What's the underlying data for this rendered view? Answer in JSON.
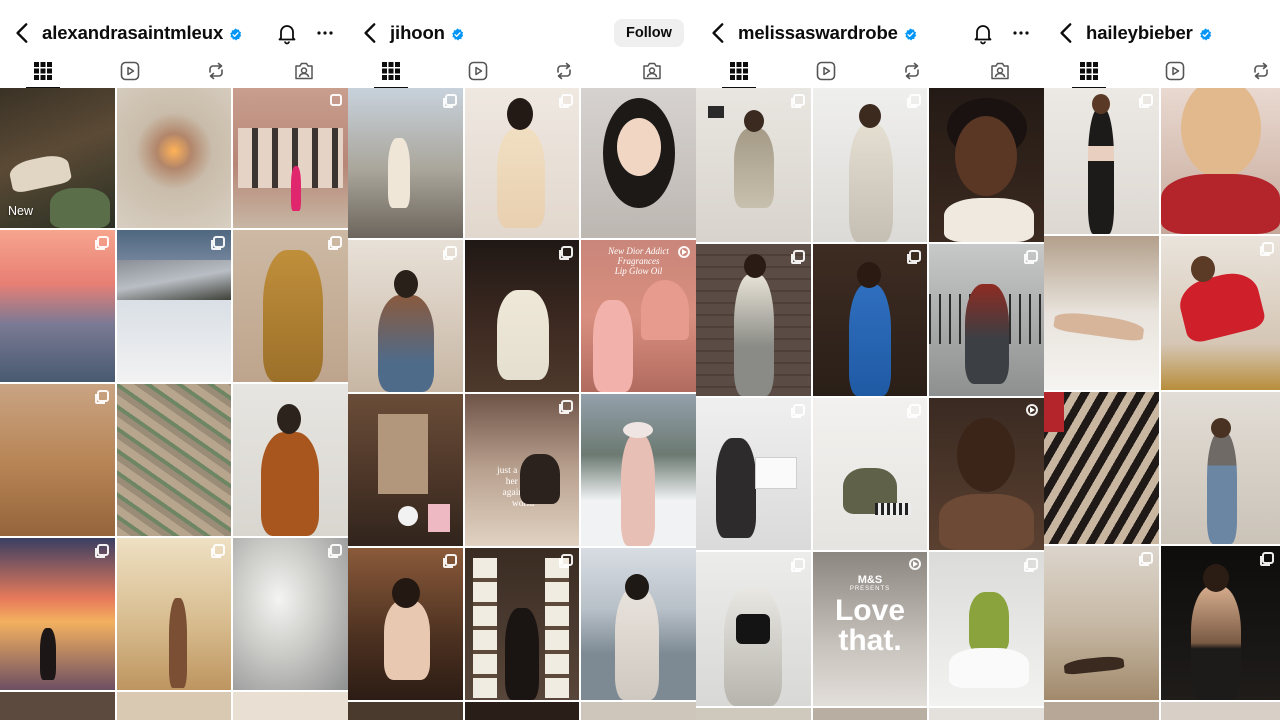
{
  "panels": [
    {
      "username": "alexandrasaintmleux",
      "verified": true,
      "right_icons": [
        "bell-icon",
        "more-icon"
      ],
      "new_label": "New"
    },
    {
      "username": "jihoon",
      "verified": true,
      "follow_label": "Follow",
      "overlays": {
        "tile_1_2": [
          "New Dior Addict",
          "Fragrances",
          "Lip Glow Oil"
        ],
        "tile_2_1": [
          "just a girl and",
          "her notes",
          "against the",
          "world"
        ]
      }
    },
    {
      "username": "melissaswardrobe",
      "verified": true,
      "right_icons": [
        "bell-icon",
        "more-icon"
      ],
      "overlays": {
        "tile_3_1_brand": "M&S",
        "tile_3_1_sub": "PRESENTS",
        "tile_3_1_title": [
          "Love",
          "that."
        ]
      }
    },
    {
      "username": "haileybieber",
      "verified": true
    }
  ],
  "tabs": [
    "grid-tab",
    "reels-tab",
    "reposts-tab",
    "tagged-tab"
  ],
  "colors": {
    "verified": "#0095f6",
    "text": "#0c0c0c",
    "follow_bg": "#efefef"
  }
}
